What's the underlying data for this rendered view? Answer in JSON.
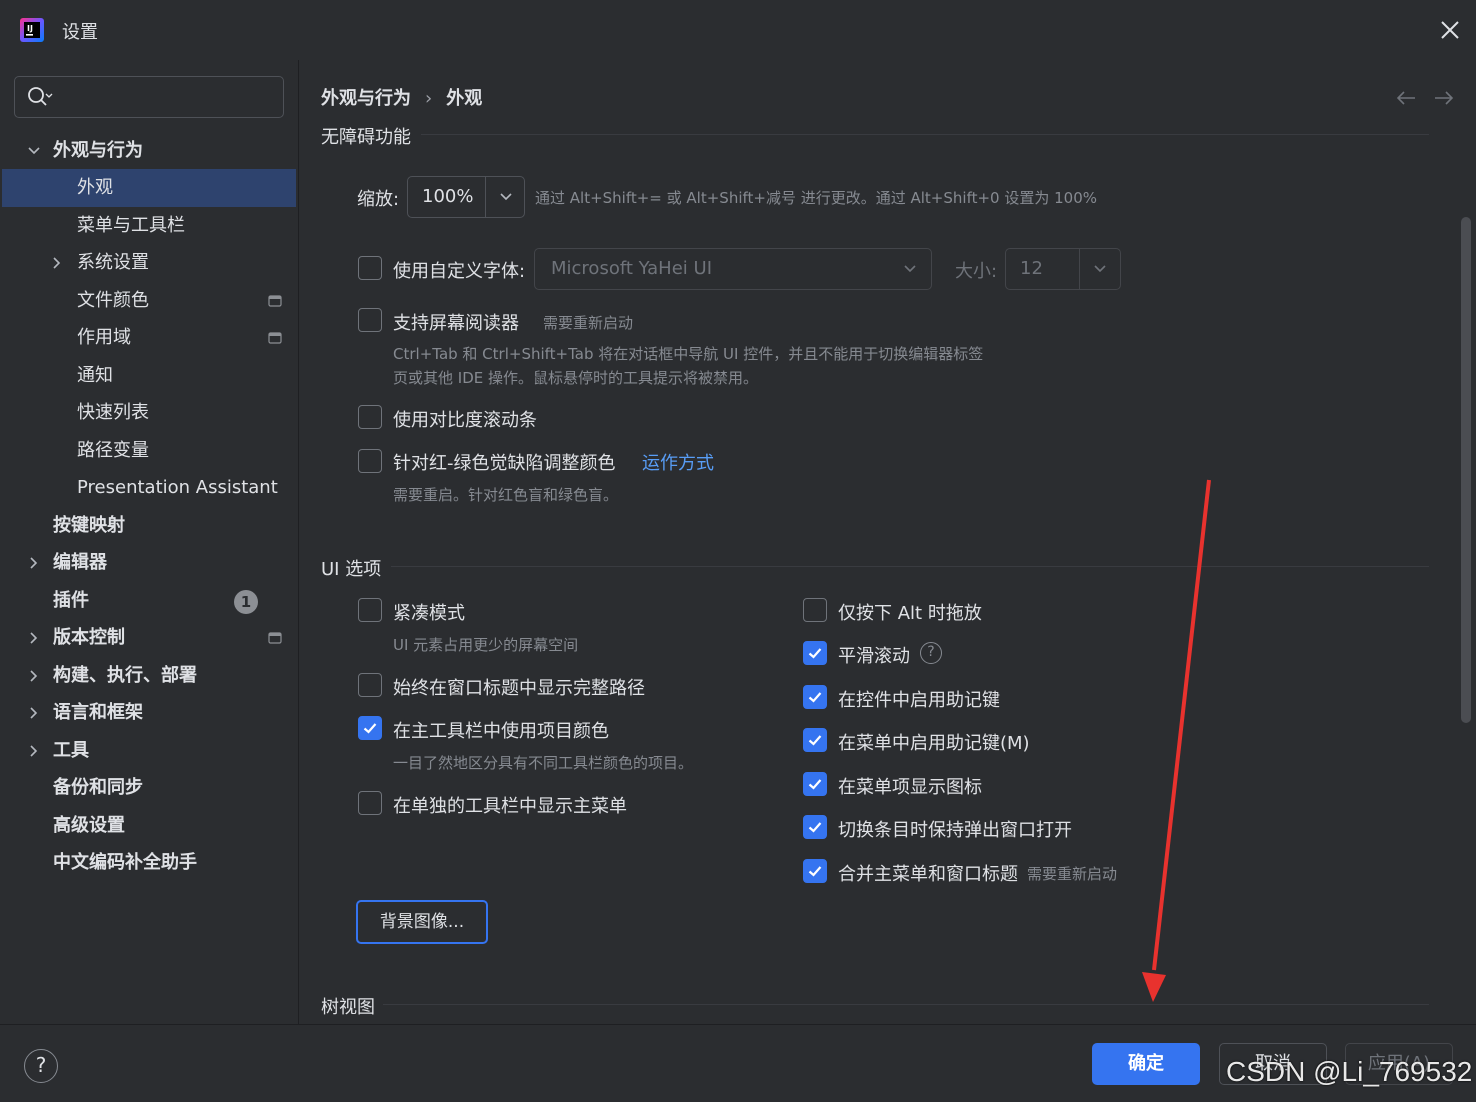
{
  "window": {
    "title": "设置"
  },
  "sidebar": {
    "search_placeholder": "",
    "items": [
      {
        "label": "外观与行为"
      },
      {
        "label": "外观"
      },
      {
        "label": "菜单与工具栏"
      },
      {
        "label": "系统设置"
      },
      {
        "label": "文件颜色"
      },
      {
        "label": "作用域"
      },
      {
        "label": "通知"
      },
      {
        "label": "快速列表"
      },
      {
        "label": "路径变量"
      },
      {
        "label": "Presentation Assistant"
      },
      {
        "label": "按键映射"
      },
      {
        "label": "编辑器"
      },
      {
        "label": "插件",
        "badge": "1"
      },
      {
        "label": "版本控制"
      },
      {
        "label": "构建、执行、部署"
      },
      {
        "label": "语言和框架"
      },
      {
        "label": "工具"
      },
      {
        "label": "备份和同步"
      },
      {
        "label": "高级设置"
      },
      {
        "label": "中文编码补全助手"
      }
    ]
  },
  "breadcrumb": {
    "parent": "外观与行为",
    "separator": "›",
    "current": "外观"
  },
  "accessibility": {
    "title": "无障碍功能",
    "zoom_label": "缩放:",
    "zoom_value": "100%",
    "zoom_hint": "通过 Alt+Shift+= 或 Alt+Shift+减号 进行更改。通过 Alt+Shift+0 设置为 100%",
    "custom_font_label": "使用自定义字体:",
    "custom_font_value": "Microsoft YaHei UI",
    "size_label": "大小:",
    "size_value": "12",
    "screen_reader_label": "支持屏幕阅读器",
    "screen_reader_hint": "需要重新启动",
    "screen_reader_desc_1": "Ctrl+Tab 和 Ctrl+Shift+Tab 将在对话框中导航 UI 控件，并且不能用于切换编辑器标签",
    "screen_reader_desc_2": "页或其他 IDE 操作。鼠标悬停时的工具提示将被禁用。",
    "contrast_scroll_label": "使用对比度滚动条",
    "color_blind_label": "针对红-绿色觉缺陷调整颜色",
    "color_blind_link": "运作方式",
    "color_blind_hint": "需要重启。针对红色盲和绿色盲。"
  },
  "ui_options": {
    "title": "UI 选项",
    "left": {
      "compact_label": "紧凑模式",
      "compact_hint": "UI 元素占用更少的屏幕空间",
      "full_path_label": "始终在窗口标题中显示完整路径",
      "project_color_label": "在主工具栏中使用项目颜色",
      "project_color_hint": "一目了然地区分具有不同工具栏颜色的项目。",
      "separate_menu_label": "在单独的工具栏中显示主菜单"
    },
    "right": {
      "alt_drag_label": "仅按下 Alt 时拖放",
      "smooth_scroll_label": "平滑滚动",
      "mnemonic_controls_label": "在控件中启用助记键",
      "mnemonic_menu_label": "在菜单中启用助记键(M)",
      "menu_icons_label": "在菜单项显示图标",
      "popup_open_label": "切换条目时保持弹出窗口打开",
      "merge_menu_label": "合并主菜单和窗口标题",
      "merge_menu_hint": "需要重新启动"
    },
    "checked": {
      "compact": false,
      "full_path": false,
      "project_color": true,
      "separate_menu": false,
      "alt_drag": false,
      "smooth_scroll": true,
      "mnemonic_controls": true,
      "mnemonic_menu": true,
      "menu_icons": true,
      "popup_open": true,
      "merge_menu": true
    },
    "background_button": "背景图像..."
  },
  "tree_view": {
    "title": "树视图"
  },
  "footer": {
    "help": "?",
    "ok": "确定",
    "cancel": "取消",
    "apply": "应用(A)"
  },
  "watermark": "CSDN @Li_769532",
  "colors": {
    "accent": "#3574f0",
    "selection": "#2e436e",
    "link": "#589df6",
    "annotation": "#e8322e"
  }
}
